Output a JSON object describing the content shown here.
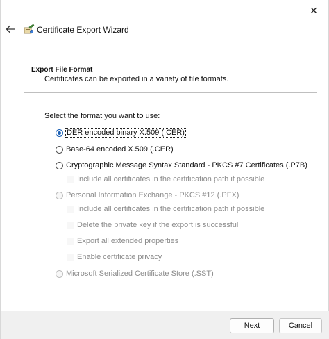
{
  "window": {
    "close_glyph": "✕"
  },
  "header": {
    "title": "Certificate Export Wizard"
  },
  "section": {
    "title": "Export File Format",
    "description": "Certificates can be exported in a variety of file formats."
  },
  "form": {
    "prompt": "Select the format you want to use:",
    "options": [
      {
        "label": "DER encoded binary X.509 (.CER)",
        "type": "radio",
        "checked": true,
        "enabled": true
      },
      {
        "label": "Base-64 encoded X.509 (.CER)",
        "type": "radio",
        "checked": false,
        "enabled": true
      },
      {
        "label": "Cryptographic Message Syntax Standard - PKCS #7 Certificates (.P7B)",
        "type": "radio",
        "checked": false,
        "enabled": true
      },
      {
        "label": "Include all certificates in the certification path if possible",
        "type": "checkbox",
        "checked": false,
        "enabled": false
      },
      {
        "label": "Personal Information Exchange - PKCS #12 (.PFX)",
        "type": "radio",
        "checked": false,
        "enabled": false
      },
      {
        "label": "Include all certificates in the certification path if possible",
        "type": "checkbox",
        "checked": false,
        "enabled": false
      },
      {
        "label": "Delete the private key if the export is successful",
        "type": "checkbox",
        "checked": false,
        "enabled": false
      },
      {
        "label": "Export all extended properties",
        "type": "checkbox",
        "checked": false,
        "enabled": false
      },
      {
        "label": "Enable certificate privacy",
        "type": "checkbox",
        "checked": false,
        "enabled": false
      },
      {
        "label": "Microsoft Serialized Certificate Store (.SST)",
        "type": "radio",
        "checked": false,
        "enabled": false
      }
    ]
  },
  "footer": {
    "next_label": "Next",
    "cancel_label": "Cancel"
  },
  "icons": {
    "back": "back-arrow-icon",
    "wizard": "certificate-icon",
    "close": "close-icon"
  },
  "colors": {
    "accent": "#1a5fb4",
    "footer_bg": "#f0f0f0",
    "disabled_text": "#8c8c8c"
  }
}
